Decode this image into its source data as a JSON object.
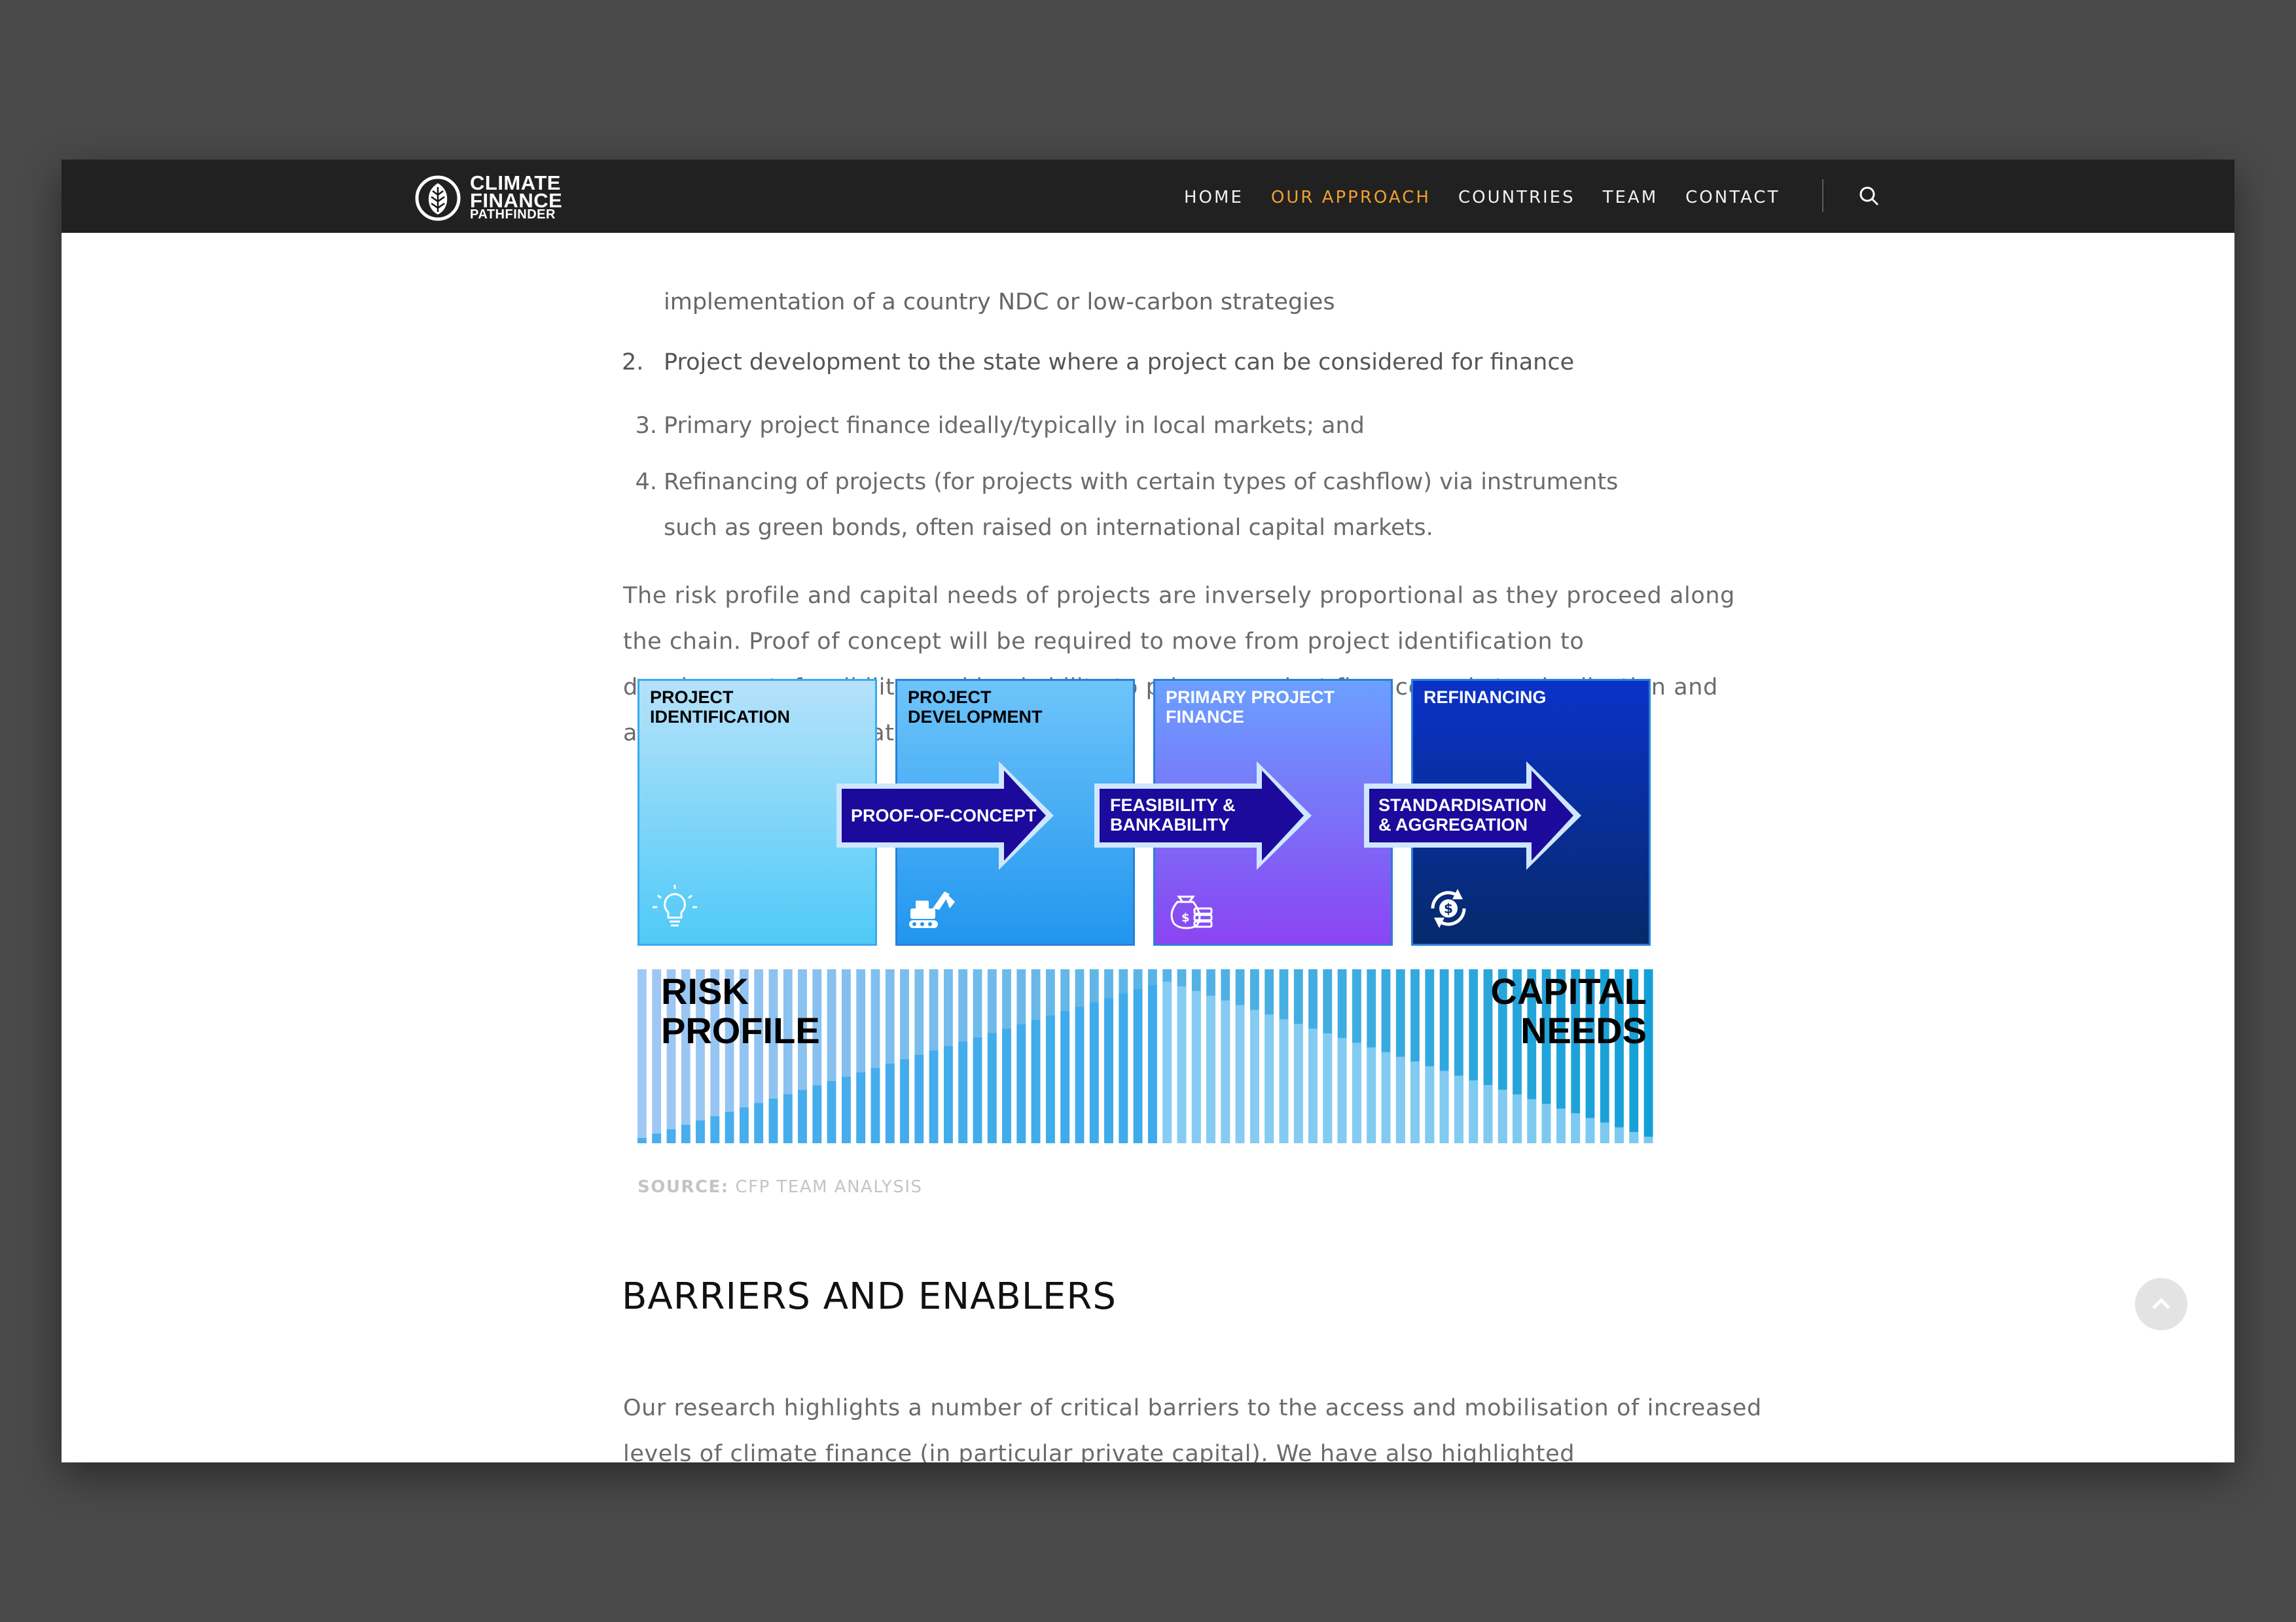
{
  "brand": {
    "name_line1": "CLIMATE",
    "name_line2": "FINANCE",
    "name_line3": "PATHFINDER"
  },
  "nav": {
    "items": [
      {
        "label": "HOME",
        "active": false
      },
      {
        "label": "OUR APPROACH",
        "active": true
      },
      {
        "label": "COUNTRIES",
        "active": false
      },
      {
        "label": "TEAM",
        "active": false
      },
      {
        "label": "CONTACT",
        "active": false
      }
    ],
    "active_color": "#f0a030",
    "search_icon": "search-icon"
  },
  "article": {
    "ghost_line_1": "implementation of a country NDC or low-carbon strategies",
    "ghost_item_2": "Project development to the state where a project can be considered for finance",
    "list": [
      {
        "num": "3.",
        "text": "Primary project finance ideally/typically in local markets; and"
      },
      {
        "num": "4.",
        "text": "Refinancing of projects (for projects with certain types of cashflow) via instruments such as green bonds, often raised on international capital markets."
      }
    ],
    "paragraph_1": "The risk profile and capital needs of projects are inversely proportional as they proceed along the chain. Proof of concept will be required to move from project identification to development, feasibility, and bankability to primary project finance and standardisation and aggregation to facilitate refinancing.",
    "heading": "BARRIERS AND ENABLERS",
    "paragraph_2": "Our research highlights a number of critical barriers to the access and mobilisation of increased levels of climate finance (in particular private capital). We have also highlighted"
  },
  "figure": {
    "stages": [
      {
        "title": "PROJECT IDENTIFICATION",
        "icon": "lightbulb-icon",
        "color_top": "#b6e2fa",
        "color_bottom": "#4fcaf7",
        "title_color": "#000000"
      },
      {
        "title": "PROJECT DEVELOPMENT",
        "icon": "excavator-icon",
        "color_top": "#6ec4fa",
        "color_bottom": "#2196ee",
        "title_color": "#000000"
      },
      {
        "title": "PRIMARY PROJECT FINANCE",
        "icon": "money-bag-icon",
        "color_top": "#6aa0ff",
        "color_bottom": "#8b44f2",
        "title_color": "#ffffff"
      },
      {
        "title": "REFINANCING",
        "icon": "refresh-dollar-icon",
        "color_top": "#0a32c9",
        "color_bottom": "#062a6a",
        "title_color": "#ffffff"
      }
    ],
    "arrows": [
      {
        "line1": "PROOF-OF-CONCEPT",
        "line2": ""
      },
      {
        "line1": "FEASIBILITY &",
        "line2": "BANKABILITY"
      },
      {
        "line1": "STANDARDISATION",
        "line2": "& AGGREGATION"
      }
    ],
    "arrow_color": "#1c0a9c",
    "risk_label_1": "RISK",
    "risk_label_2": "PROFILE",
    "capital_label_1": "CAPITAL",
    "capital_label_2": "NEEDS",
    "source_prefix": "SOURCE:",
    "source_text": "CFP TEAM ANALYSIS"
  },
  "scroll_top_icon": "chevron-up-icon"
}
